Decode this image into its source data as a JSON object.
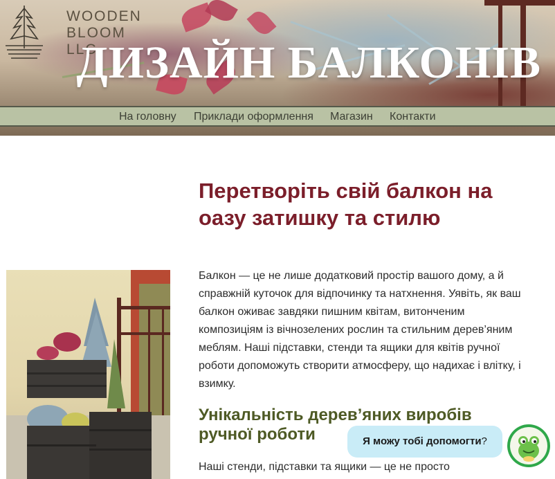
{
  "header": {
    "logo_line1": "WOODEN",
    "logo_line2": "BLOOM",
    "logo_line3": "LLC",
    "site_title": "ДИЗАЙН БАЛКОНІВ"
  },
  "nav": {
    "items": [
      {
        "label": "На головну"
      },
      {
        "label": "Приклади оформлення"
      },
      {
        "label": "Магазин"
      },
      {
        "label": "Контакти"
      }
    ]
  },
  "main": {
    "heading": "Перетворіть свій балкон на оазу затишку та стилю",
    "paragraph": "Балкон — це не лише додатковий простір вашого дому, а й справжній куточок для відпочинку та натхнення. Уявіть, як ваш балкон оживає завдяки пишним квітам, витонченим композиціям із вічнозелених рослин та стильним дерев’яним меблям. Наші підставки, стенди та ящики для квітів ручної роботи допоможуть створити атмосферу, що надихає і влітку, і взимку.",
    "subheading": "Унікальність дерев’яних виробів ручної роботи",
    "paragraph2": "Наші стенди, підставки та ящики — це не просто"
  },
  "chat": {
    "label": "Я можу тобі допомогти",
    "question_mark": "?",
    "avatar_icon": "frog-icon",
    "bubble_color": "#c9ecf7",
    "avatar_color": "#2fa84a"
  },
  "colors": {
    "heading": "#7b1e2a",
    "subheading": "#4e5a25",
    "nav_bg": "#b9c2a4"
  }
}
